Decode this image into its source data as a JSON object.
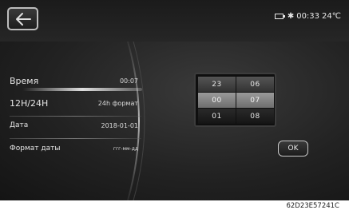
{
  "status": {
    "battery_icon": "battery-icon",
    "bluetooth_icon": "bluetooth-icon",
    "time": "00:33",
    "temperature": "24℃"
  },
  "settings": [
    {
      "label": "Время",
      "value": "00:07"
    },
    {
      "label": "12H/24H",
      "value": "24h формат"
    },
    {
      "label": "Дата",
      "value": "2018-01-01"
    },
    {
      "label": "Формат даты",
      "value": "ггг-мм-дд"
    }
  ],
  "picker": {
    "hours": [
      "23",
      "00",
      "01"
    ],
    "minutes": [
      "06",
      "07",
      "08"
    ]
  },
  "ok_label": "OK",
  "caption": "62D23E57241C"
}
